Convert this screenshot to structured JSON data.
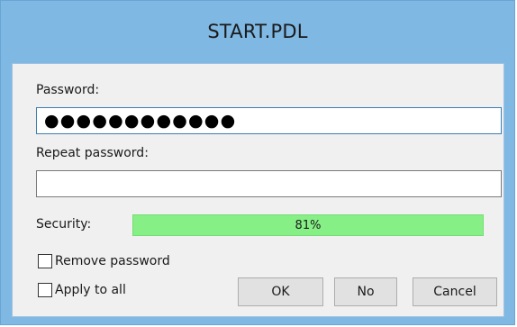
{
  "dialog": {
    "title": "START.PDL",
    "password_label": "Password:",
    "password_value": "●●●●●●●●●●●●",
    "repeat_label": "Repeat password:",
    "repeat_value": "",
    "security_label": "Security:",
    "security_value": "81%",
    "security_fraction": 0.81,
    "remove_password_label": "Remove password",
    "apply_to_all_label": "Apply to all",
    "ok_label": "OK",
    "no_label": "No",
    "cancel_label": "Cancel"
  },
  "colors": {
    "frame": "#7fb8e3",
    "security_bar": "#86f086"
  }
}
